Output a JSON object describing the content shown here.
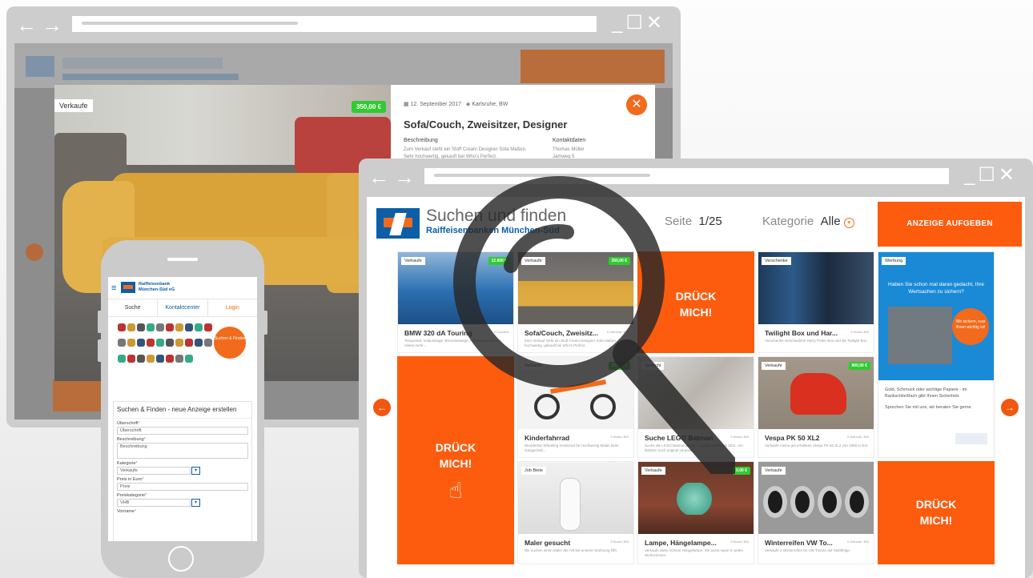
{
  "back_window": {
    "tag": "Verkaufe",
    "price": "350,00 €",
    "date": "12. September 2017",
    "location": "Karlsruhe, BW",
    "title": "Sofa/Couch, Zweisitzer, Designer",
    "desc_label": "Beschreibung",
    "desc_text": "Zum Verkauf steht ein Stoff Cream Designer Sofa Maßen. Sehr hochwertig, gekauft bei Who's Perfect.",
    "contact_label": "Kontaktdaten",
    "contact_name": "Thomas Müller",
    "contact_extra": "Jamweg 5",
    "close_icon": "close-icon"
  },
  "phone": {
    "brand_line1": "Raiffeisenbank",
    "brand_line2": "München-Süd eG",
    "tabs": [
      "Suche",
      "Kontaktcenter",
      "Login"
    ],
    "badge": "Suchen & Finden",
    "form": {
      "title": "Suchen & Finden - neue Anzeige erstellen",
      "fields": [
        {
          "label": "Überschrift",
          "value": "Überschrift"
        },
        {
          "label": "Beschreibung",
          "value": "Beschreibung"
        },
        {
          "label": "Kategorie",
          "value": "Verkaufe"
        },
        {
          "label": "Preis in Euro",
          "value": "Preis"
        },
        {
          "label": "Preiskategorie",
          "value": "VHB"
        },
        {
          "label": "Vorname",
          "value": ""
        }
      ]
    }
  },
  "main": {
    "title": "Suchen und finden",
    "subtitle": "Raiffeisenbanken München-Süd",
    "page_label": "Seite",
    "page_value": "1/25",
    "category_label": "Kategorie",
    "category_value": "Alle",
    "cta": "ANZEIGE AUFGEBEN",
    "press_me": [
      "DRÜCK",
      "MICH!"
    ],
    "cards": [
      {
        "title": "BMW 320 dA Touring",
        "tag": "Verkaufe",
        "price": "12.800 €",
        "date": "3 Counted",
        "text": "Tempomat, Volausstage, Bremsbelaege, Anhaengekupplung, Vieles mehr..."
      },
      {
        "title": "Sofa/Couch, Zweisitz...",
        "tag": "Verkaufe",
        "price": "350,00 €",
        "date": "3 Gefunde, BW",
        "text": "Zum Verkauf steht ein Stoff Cream Designer Sofa Maßen, sehr hochwertig, gekauft bei Who's Perfect."
      },
      {
        "title": "Twilight Box und Har...",
        "tag": "Verschenke",
        "date": "3 Hours, BW",
        "text": "Verschenke verschiedene Harry Potter Box und die Twilight Box."
      },
      {
        "title": "Kinderfahrrad",
        "tag": "Verkaufe",
        "price": "230,00 €",
        "date": "3 Hours, BW",
        "text": "Wunderbar Wheeling Kinderrad für Hochwertig Malas beim Gangschalt..."
      },
      {
        "title": "Suche LEGO Batman",
        "tag": "Gesucht",
        "date": "3 Hours, BW",
        "text": "Suche die LEGO Batman Bodie, Ausgabe 1989, bis 2011. Am liebsten noch original verpackt."
      },
      {
        "title": "Vespa PK 50 XL2",
        "tag": "Verkaufe",
        "price": "900,00 €",
        "date": "3 Gefunde, BW",
        "text": "Verkaufe meine gut erhaltene Vespa PK 50 XL2 von 1990 in Rot."
      },
      {
        "title": "Maler gesucht",
        "tag": "Job Biete",
        "date": "3 Hours, BW",
        "text": "Wir suchen einen Maler der mit bei unserer Wohnung hilft."
      },
      {
        "title": "Lampe, Hängelampe...",
        "tag": "Verkaufe",
        "price": "0,00 €",
        "date": "3 Hours, BW",
        "text": "Verkaufe diese schöne Hängelampe. Sie passt super in jedes Wohnzimmer."
      },
      {
        "title": "Winterreifen VW To...",
        "tag": "Verkaufe",
        "date": "3 Gefunde, BW",
        "text": "Verkaufe 4 Winterreifen für VW Touran auf Stahlfelge."
      }
    ],
    "ad": {
      "tag": "Werbung",
      "question": "Haben Sie schon mal daran gedacht, Ihre Wertsachen zu sichern?",
      "badge": "Wir sichern, was Ihnen wichtig ist!",
      "text1": "Gold, Schmuck oder wichtige Papiere - im Bankschließfach gibt Ihnen Sicherheit.",
      "text2": "Sprechen Sie mit uns, wir beraten Sie gerne."
    }
  },
  "colors": {
    "orange": "#fd5b0d",
    "blue": "#0b5ea7",
    "green": "#2fcb2f"
  }
}
